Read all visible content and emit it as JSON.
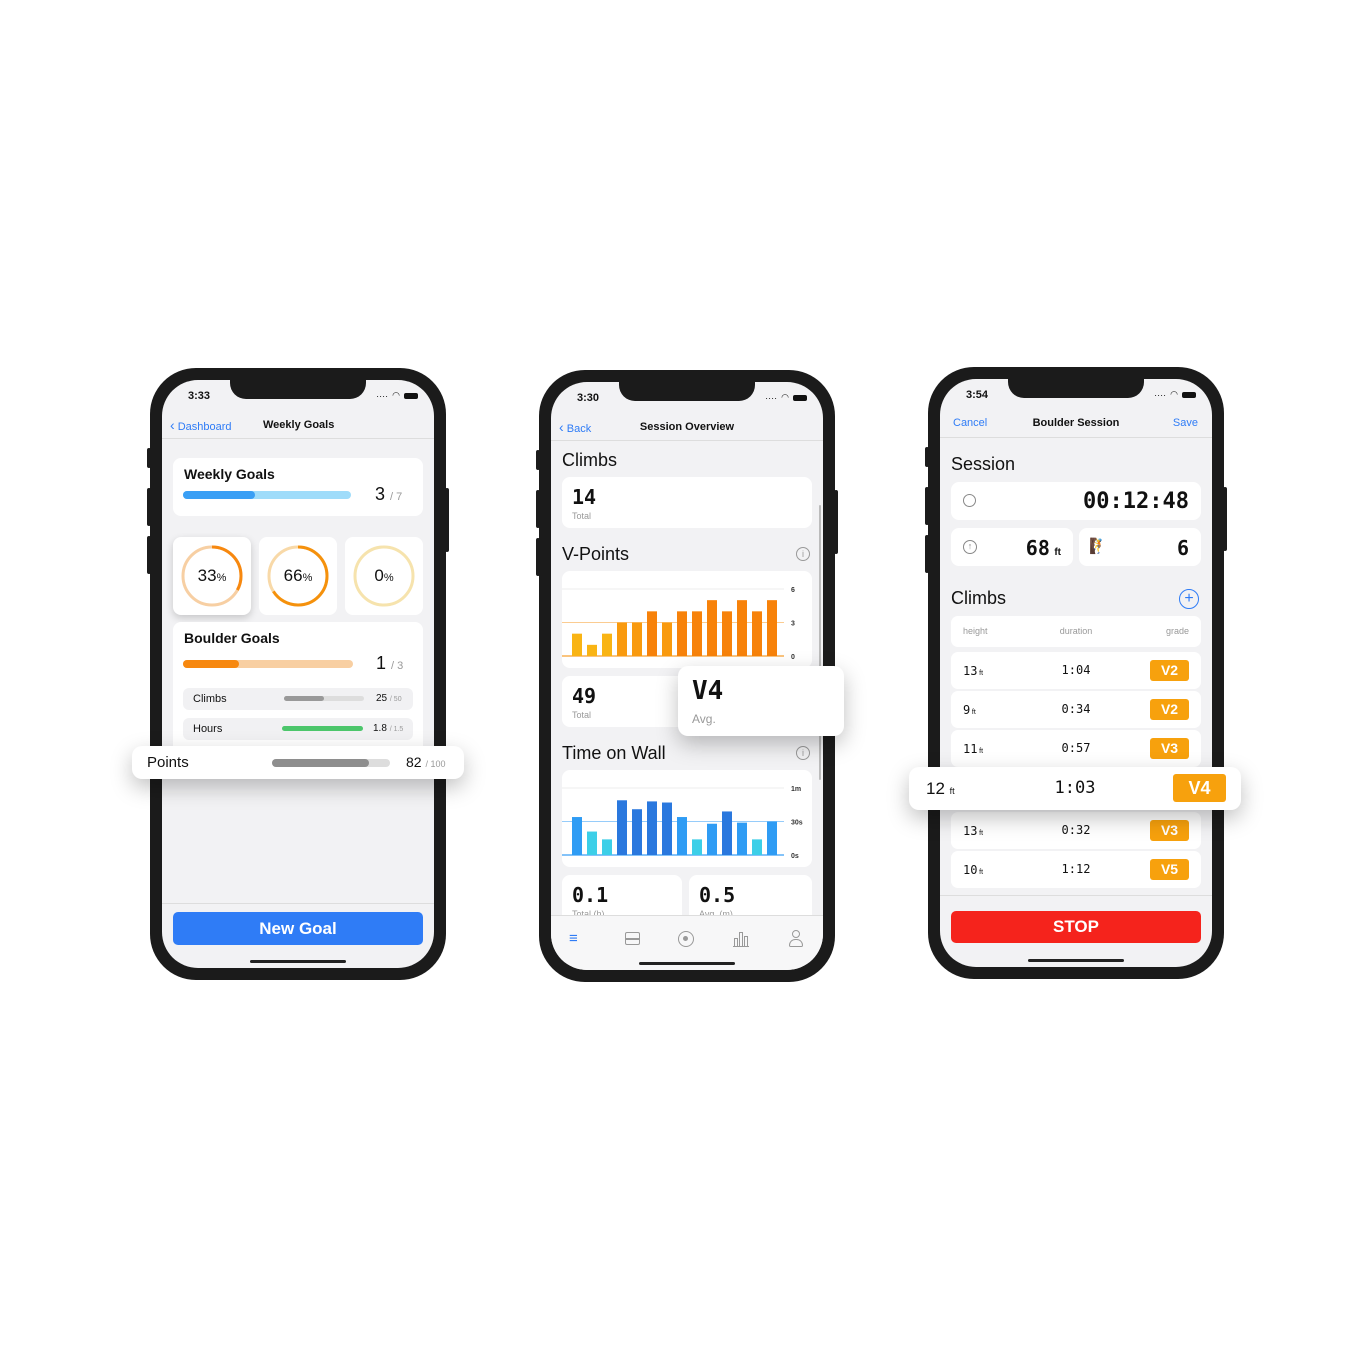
{
  "colors": {
    "accent": "#2f7cf6",
    "orange": "#f7880f",
    "stop": "#f5231c",
    "green": "#4cc66b",
    "grade": "#f7a10d"
  },
  "phone1": {
    "time": "3:33",
    "back": "Dashboard",
    "title": "Weekly Goals",
    "weekly": {
      "title": "Weekly Goals",
      "value": "3",
      "total": "/ 7",
      "progress": 0.43
    },
    "rings": [
      {
        "value": "33",
        "unit": "%",
        "progress": 0.33
      },
      {
        "value": "66",
        "unit": "%",
        "progress": 0.66
      },
      {
        "value": "0",
        "unit": "%",
        "progress": 0
      }
    ],
    "boulder": {
      "title": "Boulder Goals",
      "value": "1",
      "total": "/ 3",
      "progress": 0.33,
      "rows": [
        {
          "label": "Climbs",
          "value": "25",
          "total": "/ 50",
          "progress": 0.5
        },
        {
          "label": "Hours",
          "value": "1.8",
          "total": "/ 1.5",
          "progress": 1.0
        }
      ]
    },
    "points": {
      "label": "Points",
      "value": "82",
      "total": "/ 100",
      "progress": 0.82
    },
    "new_goal": "New Goal"
  },
  "phone2": {
    "time": "3:30",
    "back": "Back",
    "title": "Session Overview",
    "climbs": {
      "heading": "Climbs",
      "value": "14",
      "label": "Total"
    },
    "vpoints": {
      "heading": "V-Points",
      "total": "49",
      "total_label": "Total",
      "avg": "V4",
      "avg_label": "Avg."
    },
    "time_on_wall": {
      "heading": "Time on Wall",
      "total": "0.1",
      "total_label": "Total (h)",
      "avg": "0.5",
      "avg_label": "Avg. (m)"
    },
    "tabs": [
      {
        "icon": "list-icon",
        "active": true
      },
      {
        "icon": "board-icon"
      },
      {
        "icon": "record-icon"
      },
      {
        "icon": "chart-icon"
      },
      {
        "icon": "profile-icon"
      }
    ]
  },
  "chart_data": [
    {
      "type": "bar",
      "ylim": [
        0,
        6
      ],
      "yticks": [
        "6",
        "3",
        "0"
      ],
      "values": [
        2,
        1,
        2,
        3,
        3,
        4,
        3,
        4,
        4,
        5,
        4,
        5,
        4,
        5
      ]
    },
    {
      "type": "bar",
      "ylim": [
        0,
        60
      ],
      "yticks": [
        "1m",
        "30s",
        "0s"
      ],
      "values": [
        34,
        21,
        14,
        49,
        41,
        48,
        47,
        34,
        14,
        28,
        39,
        29,
        14,
        30
      ]
    }
  ],
  "phone3": {
    "time": "3:54",
    "cancel": "Cancel",
    "title": "Boulder Session",
    "save": "Save",
    "session_heading": "Session",
    "timer": "00:12:48",
    "height": "68",
    "height_unit": "ft",
    "count": "6",
    "climbs_heading": "Climbs",
    "columns": [
      "height",
      "duration",
      "grade"
    ],
    "rows": [
      {
        "height": "13",
        "unit": "ft",
        "duration": "1:04",
        "grade": "V2"
      },
      {
        "height": "9",
        "unit": "ft",
        "duration": "0:34",
        "grade": "V2"
      },
      {
        "height": "11",
        "unit": "ft",
        "duration": "0:57",
        "grade": "V3"
      },
      {
        "height": "12",
        "unit": "ft",
        "duration": "1:03",
        "grade": "V4",
        "highlighted": true
      },
      {
        "height": "13",
        "unit": "ft",
        "duration": "0:32",
        "grade": "V3"
      },
      {
        "height": "10",
        "unit": "ft",
        "duration": "1:12",
        "grade": "V5"
      }
    ],
    "stop": "STOP"
  }
}
